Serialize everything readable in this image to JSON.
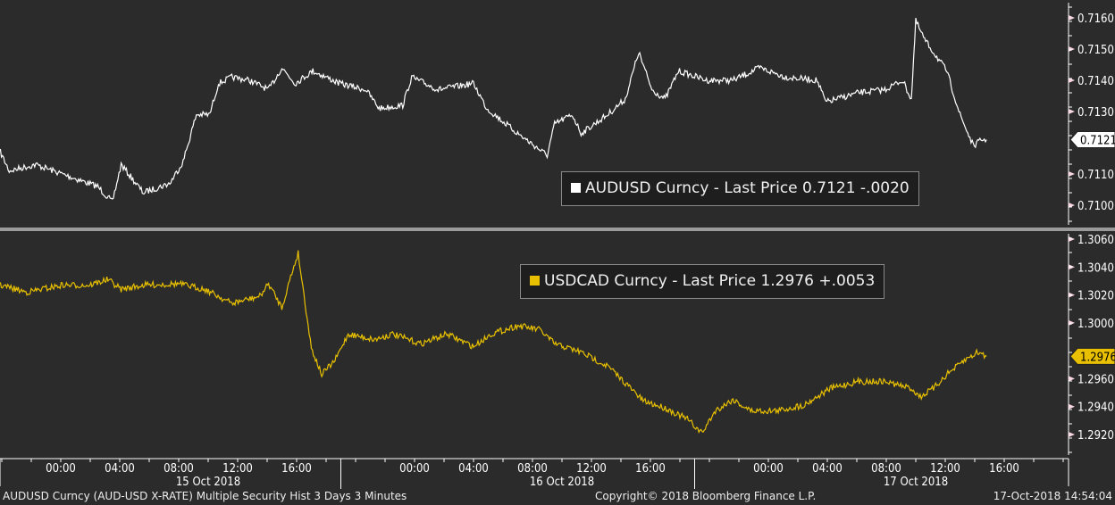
{
  "colors": {
    "background": "#2b2b2b",
    "audusd": "#ffffff",
    "usdcad": "#e8c000",
    "separator": "#9a9a9a"
  },
  "chart_data": [
    {
      "type": "line",
      "name": "AUDUSD",
      "ylim": [
        0.7095,
        0.7166
      ],
      "yticks": [
        "0.7160",
        "0.7150",
        "0.7140",
        "0.7130",
        "0.7110",
        "0.7100"
      ],
      "last_label": "0.7121",
      "legend": "AUDUSD Curncy - Last Price 0.7121  -.0020",
      "x_unit": "hours since 15 Oct 2018 00:00",
      "points": [
        [
          -4.1,
          0.7117
        ],
        [
          -3.5,
          0.7111
        ],
        [
          -1.7,
          0.7113
        ],
        [
          0.7,
          0.7109
        ],
        [
          2.5,
          0.7106
        ],
        [
          3.5,
          0.7101
        ],
        [
          4.1,
          0.7113
        ],
        [
          5.6,
          0.7104
        ],
        [
          7.4,
          0.7107
        ],
        [
          8.3,
          0.7114
        ],
        [
          9.2,
          0.7129
        ],
        [
          10.1,
          0.7129
        ],
        [
          10.7,
          0.7139
        ],
        [
          11.6,
          0.7141
        ],
        [
          12.8,
          0.714
        ],
        [
          14.1,
          0.7137
        ],
        [
          15.0,
          0.7144
        ],
        [
          15.9,
          0.7139
        ],
        [
          17.1,
          0.7143
        ],
        [
          18.9,
          0.7139
        ],
        [
          20.7,
          0.7137
        ],
        [
          21.6,
          0.7131
        ],
        [
          23.2,
          0.7132
        ],
        [
          23.8,
          0.7141
        ],
        [
          25.6,
          0.7137
        ],
        [
          28.0,
          0.7139
        ],
        [
          28.9,
          0.7131
        ],
        [
          31.0,
          0.7123
        ],
        [
          33.0,
          0.7116
        ],
        [
          33.5,
          0.7126
        ],
        [
          34.7,
          0.7129
        ],
        [
          35.3,
          0.7123
        ],
        [
          37.1,
          0.7129
        ],
        [
          38.3,
          0.7134
        ],
        [
          39.2,
          0.7149
        ],
        [
          40.1,
          0.7137
        ],
        [
          41.0,
          0.7134
        ],
        [
          41.9,
          0.7143
        ],
        [
          43.8,
          0.714
        ],
        [
          45.6,
          0.714
        ],
        [
          47.4,
          0.7144
        ],
        [
          49.2,
          0.7141
        ],
        [
          51.3,
          0.714
        ],
        [
          51.9,
          0.7133
        ],
        [
          54.1,
          0.7136
        ],
        [
          55.9,
          0.7137
        ],
        [
          57.1,
          0.714
        ],
        [
          57.7,
          0.7134
        ],
        [
          58.0,
          0.7159
        ],
        [
          58.6,
          0.7153
        ],
        [
          59.5,
          0.7147
        ],
        [
          60.1,
          0.7143
        ],
        [
          61.0,
          0.7129
        ],
        [
          61.9,
          0.7119
        ],
        [
          62.5,
          0.7121
        ],
        [
          62.8,
          0.7121
        ]
      ]
    },
    {
      "type": "line",
      "name": "USDCAD",
      "ylim": [
        1.2906,
        1.3066
      ],
      "yticks": [
        "1.3060",
        "1.3040",
        "1.3020",
        "1.3000",
        "1.2960",
        "1.2940",
        "1.2920"
      ],
      "last_label": "1.2976",
      "legend": "USDCAD Curncy - Last Price 1.2976  +.0053",
      "x_unit": "hours since 15 Oct 2018 00:00",
      "points": [
        [
          -4.1,
          1.3027
        ],
        [
          -2.3,
          1.3022
        ],
        [
          0.1,
          1.3027
        ],
        [
          1.9,
          1.3027
        ],
        [
          3.2,
          1.3031
        ],
        [
          4.1,
          1.3024
        ],
        [
          5.6,
          1.3027
        ],
        [
          8.0,
          1.3028
        ],
        [
          9.8,
          1.3024
        ],
        [
          11.6,
          1.3014
        ],
        [
          13.5,
          1.3019
        ],
        [
          14.1,
          1.3028
        ],
        [
          15.0,
          1.3011
        ],
        [
          15.6,
          1.3033
        ],
        [
          16.1,
          1.305
        ],
        [
          16.5,
          1.302
        ],
        [
          17.0,
          1.2982
        ],
        [
          17.7,
          1.2963
        ],
        [
          18.6,
          1.2973
        ],
        [
          19.5,
          1.2992
        ],
        [
          21.3,
          1.2988
        ],
        [
          22.5,
          1.2992
        ],
        [
          24.4,
          1.2985
        ],
        [
          26.2,
          1.2992
        ],
        [
          28.0,
          1.2983
        ],
        [
          29.2,
          1.2992
        ],
        [
          31.0,
          1.2998
        ],
        [
          32.5,
          1.2995
        ],
        [
          33.5,
          1.2985
        ],
        [
          35.3,
          1.2979
        ],
        [
          37.1,
          1.2969
        ],
        [
          38.3,
          1.2957
        ],
        [
          39.5,
          1.2944
        ],
        [
          41.0,
          1.2939
        ],
        [
          42.5,
          1.2931
        ],
        [
          43.5,
          1.2921
        ],
        [
          44.4,
          1.2937
        ],
        [
          45.6,
          1.2945
        ],
        [
          46.8,
          1.2937
        ],
        [
          48.6,
          1.2937
        ],
        [
          50.4,
          1.2941
        ],
        [
          52.2,
          1.2953
        ],
        [
          54.1,
          1.2958
        ],
        [
          55.9,
          1.2958
        ],
        [
          57.7,
          1.2953
        ],
        [
          58.3,
          1.2947
        ],
        [
          59.2,
          1.2953
        ],
        [
          60.1,
          1.2963
        ],
        [
          61.3,
          1.2973
        ],
        [
          62.2,
          1.2979
        ],
        [
          62.8,
          1.2976
        ]
      ]
    }
  ],
  "xaxis": {
    "ticks": [
      {
        "h": 0,
        "label": "00:00"
      },
      {
        "h": 4,
        "label": "04:00"
      },
      {
        "h": 8,
        "label": "08:00"
      },
      {
        "h": 12,
        "label": "12:00"
      },
      {
        "h": 16,
        "label": "16:00"
      },
      {
        "h": 24,
        "label": "00:00"
      },
      {
        "h": 28,
        "label": "04:00"
      },
      {
        "h": 32,
        "label": "08:00"
      },
      {
        "h": 36,
        "label": "12:00"
      },
      {
        "h": 40,
        "label": "16:00"
      },
      {
        "h": 48,
        "label": "00:00"
      },
      {
        "h": 52,
        "label": "04:00"
      },
      {
        "h": 56,
        "label": "08:00"
      },
      {
        "h": 60,
        "label": "12:00"
      },
      {
        "h": 64,
        "label": "16:00"
      }
    ],
    "dates": [
      {
        "h": 10,
        "label": "15 Oct 2018"
      },
      {
        "h": 34,
        "label": "16 Oct 2018"
      },
      {
        "h": 58,
        "label": "17 Oct 2018"
      }
    ],
    "dividers": [
      19,
      43
    ]
  },
  "footer": {
    "left": "AUDUSD Curncy (AUD-USD X-RATE) Multiple Security Hist   3 Days 3 Minutes",
    "center": "Copyright© 2018 Bloomberg Finance L.P.",
    "right": "17-Oct-2018 14:54:04"
  }
}
